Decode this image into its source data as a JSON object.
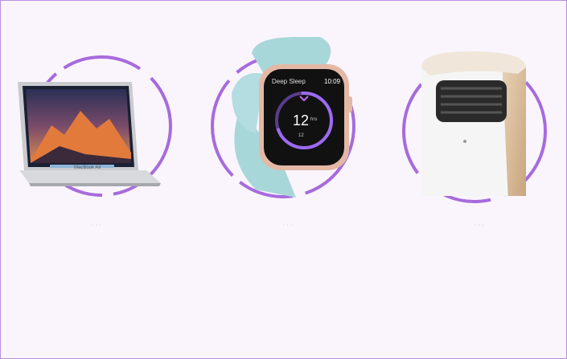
{
  "products": [
    {
      "name": "Laptop",
      "icon": "laptop-image",
      "caption": "...",
      "screen_label": "MacBook Air"
    },
    {
      "name": "Smartwatch",
      "icon": "smartwatch-image",
      "caption": "...",
      "watch_title": "Deep Sleep",
      "watch_time": "10:09",
      "watch_big": "12",
      "watch_unit": "hrs",
      "watch_small": "12"
    },
    {
      "name": "Air purifier",
      "icon": "air-purifier-image",
      "caption": "..."
    }
  ],
  "colors": {
    "background": "#faf5fd",
    "accent_purple": "#9b5ad6",
    "border": "#b48fe0",
    "caption_text": "#f4dcef"
  }
}
